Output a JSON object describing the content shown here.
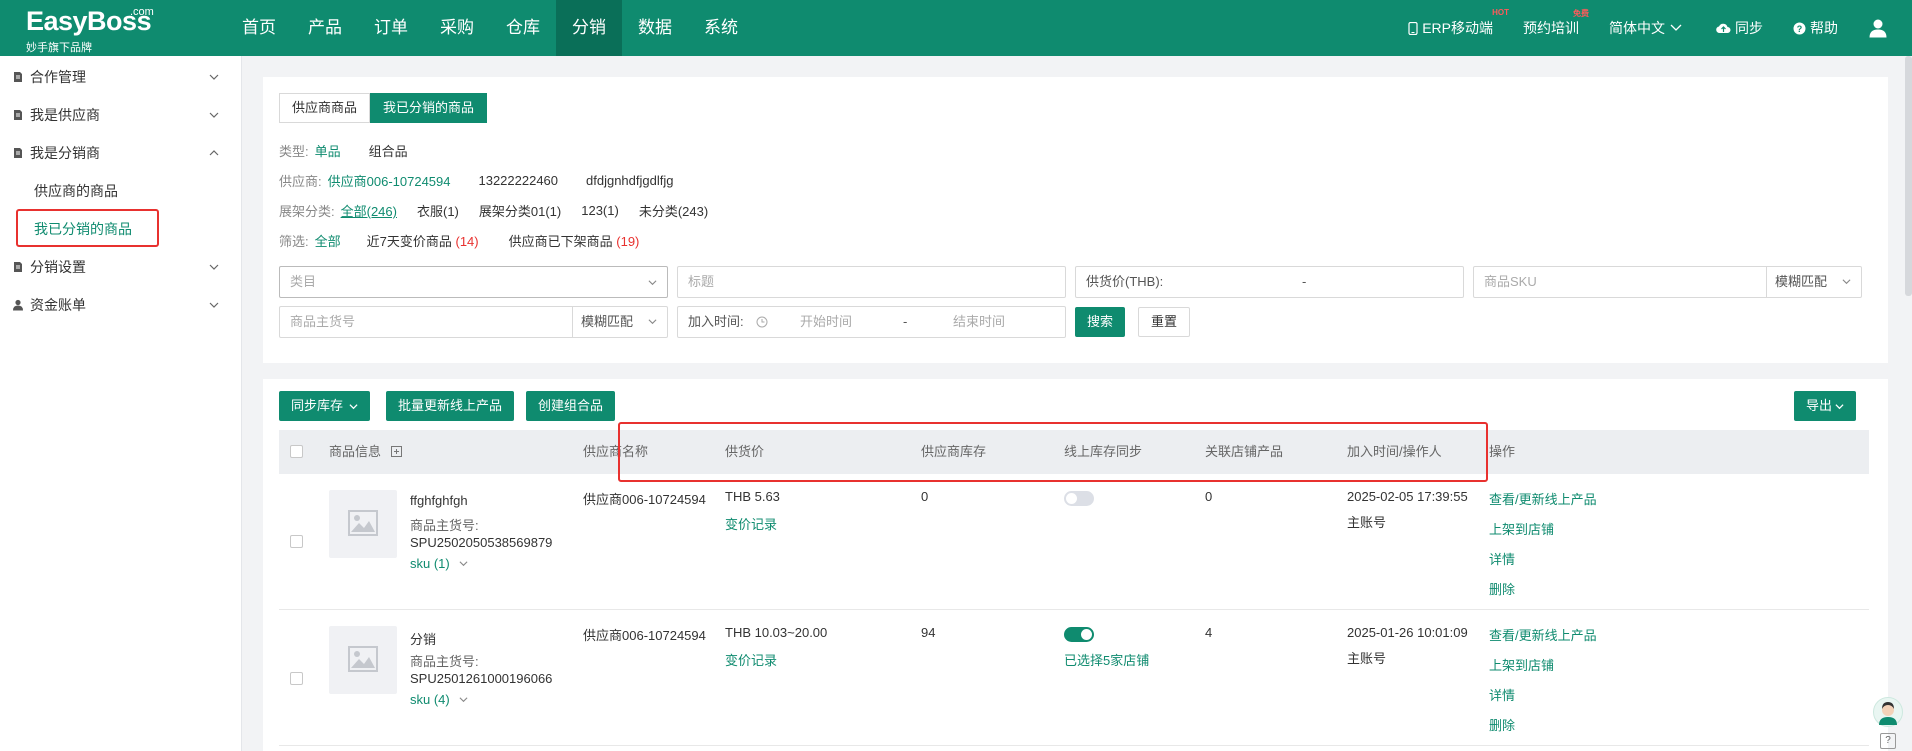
{
  "brand": {
    "logo": "EasyBoss",
    "logo_suffix": ".com",
    "tagline": "妙手旗下品牌",
    "primary_color": "#0f8b6f",
    "highlight_color": "#e8312f"
  },
  "topnav": {
    "items": [
      "首页",
      "产品",
      "订单",
      "采购",
      "仓库",
      "分销",
      "数据",
      "系统"
    ],
    "active": "分销",
    "right": {
      "mobile": "ERP移动端",
      "mobile_badge": "HOT",
      "training": "预约培训",
      "training_badge": "免费",
      "language": "简体中文",
      "sync": "同步",
      "help": "帮助"
    }
  },
  "sidebar": {
    "groups": [
      {
        "label": "合作管理",
        "icon": "doc-icon",
        "expanded": false
      },
      {
        "label": "我是供应商",
        "icon": "doc-icon",
        "expanded": false
      },
      {
        "label": "我是分销商",
        "icon": "doc-icon",
        "expanded": true,
        "children": [
          "供应商的商品",
          "我已分销的商品"
        ],
        "active_child": "我已分销的商品"
      },
      {
        "label": "分销设置",
        "icon": "doc-icon",
        "expanded": false
      },
      {
        "label": "资金账单",
        "icon": "user-icon",
        "expanded": false
      }
    ]
  },
  "filters": {
    "tabs": [
      "供应商商品",
      "我已分销的商品"
    ],
    "active_tab": "我已分销的商品",
    "type": {
      "label": "类型:",
      "options": [
        "单品",
        "组合品"
      ],
      "active": "单品"
    },
    "supplier": {
      "label": "供应商:",
      "options": [
        "供应商006-10724594",
        "13222222460",
        "dfdjgnhdfjgdlfjg"
      ],
      "active": "供应商006-10724594"
    },
    "shelf": {
      "label": "展架分类:",
      "options": [
        "全部(246)",
        "衣服(1)",
        "展架分类01(1)",
        "123(1)",
        "未分类(243)"
      ],
      "active": "全部(246)"
    },
    "screen": {
      "label": "筛选:",
      "all": "全部",
      "recent_label": "近7天变价商品",
      "recent_count": "(14)",
      "offshelf_label": "供应商已下架商品",
      "offshelf_count": "(19)"
    },
    "category_placeholder": "类目",
    "title_placeholder": "标题",
    "price_label": "供货价(THB):",
    "price_sep": "-",
    "sku_placeholder": "商品SKU",
    "sku_match": "模糊匹配",
    "spu_placeholder": "商品主货号",
    "spu_match": "模糊匹配",
    "time_label": "加入时间:",
    "time_start": "开始时间",
    "time_sep": "-",
    "time_end": "结束时间",
    "search_btn": "搜索",
    "reset_btn": "重置"
  },
  "toolbar": {
    "sync_stock": "同步库存",
    "batch_update": "批量更新线上产品",
    "create_combo": "创建组合品",
    "export": "导出"
  },
  "table": {
    "headers": {
      "product": "商品信息",
      "supplier": "供应商名称",
      "price": "供货价",
      "stock": "供应商库存",
      "sync": "线上库存同步",
      "linked": "关联店铺产品",
      "time": "加入时间/操作人",
      "ops": "操作"
    },
    "rows": [
      {
        "name": "ffghfghfgh",
        "spu_label": "商品主货号:",
        "spu": "SPU2502050538569879",
        "sku": "sku (1)",
        "supplier": "供应商006-10724594",
        "price": "THB 5.63",
        "price_history": "变价记录",
        "stock": "0",
        "sync_on": false,
        "sync_note": "",
        "linked": "0",
        "time": "2025-02-05 17:39:55",
        "operator": "主账号",
        "ops": [
          "查看/更新线上产品",
          "上架到店铺",
          "详情",
          "删除"
        ]
      },
      {
        "name": "分销",
        "spu_label": "商品主货号:",
        "spu": "SPU2501261000196066",
        "sku": "sku (4)",
        "supplier": "供应商006-10724594",
        "price": "THB 10.03~20.00",
        "price_history": "变价记录",
        "stock": "94",
        "sync_on": true,
        "sync_note": "已选择5家店铺",
        "linked": "4",
        "time": "2025-01-26 10:01:09",
        "operator": "主账号",
        "ops": [
          "查看/更新线上产品",
          "上架到店铺",
          "详情",
          "删除"
        ]
      }
    ]
  },
  "float": {
    "help": "?"
  }
}
